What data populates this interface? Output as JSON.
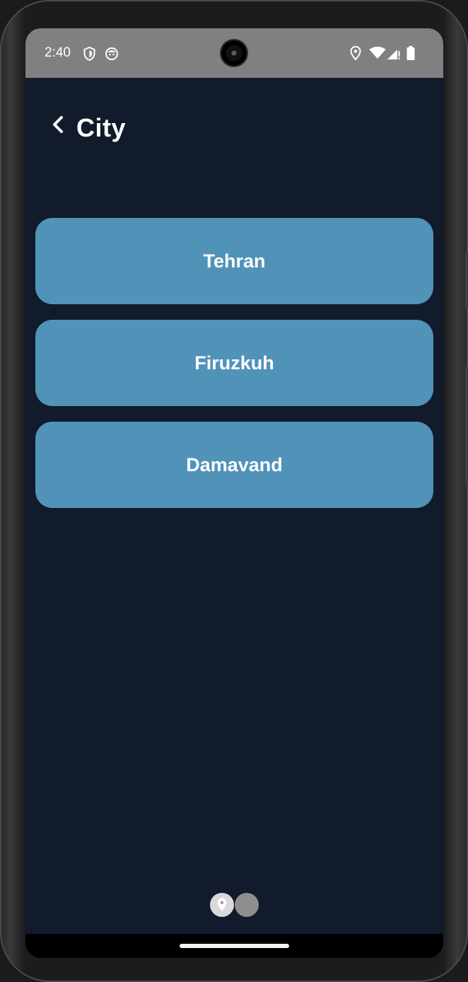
{
  "status_bar": {
    "time": "2:40",
    "left_icons": [
      "shield-icon",
      "face-icon"
    ],
    "right_icons": [
      "location-icon",
      "wifi-icon",
      "signal-icon",
      "battery-icon"
    ]
  },
  "header": {
    "back_icon": "chevron-left-icon",
    "title": "City"
  },
  "cities": [
    {
      "label": "Tehran"
    },
    {
      "label": "Firuzkuh"
    },
    {
      "label": "Damavand"
    }
  ],
  "pager": {
    "active_icon": "location-icon",
    "count": 2,
    "active_index": 0
  },
  "colors": {
    "background": "#111b2b",
    "city_button": "#5192b9",
    "status_bar": "#808080",
    "text": "#ffffff"
  }
}
